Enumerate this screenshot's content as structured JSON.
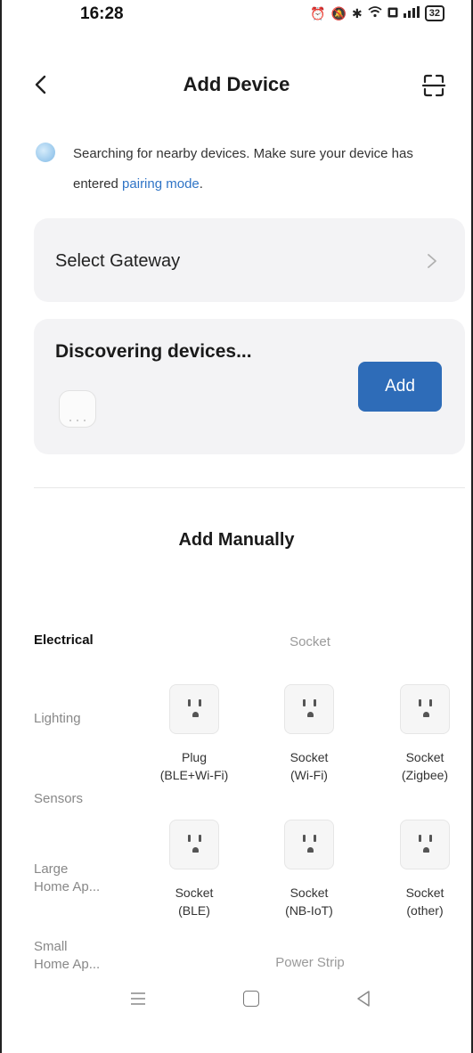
{
  "status_bar": {
    "time": "16:28",
    "battery": "32",
    "icons": [
      "alarm-icon",
      "mute-icon",
      "bluetooth-icon",
      "wifi-icon",
      "data-icon",
      "signal-icon",
      "battery-icon"
    ]
  },
  "header": {
    "title": "Add Device",
    "back_icon": "chevron-left-icon",
    "scan_icon": "scan-icon"
  },
  "info": {
    "text": "Searching for nearby devices. Make sure your device has entered ",
    "link": "pairing mode",
    "suffix": "."
  },
  "gateway": {
    "label": "Select Gateway"
  },
  "discover": {
    "title": "Discovering devices...",
    "add_label": "Add"
  },
  "manual": {
    "title": "Add Manually"
  },
  "categories": [
    {
      "label": "Electrical",
      "active": true
    },
    {
      "label": "Lighting",
      "active": false
    },
    {
      "label": "Sensors",
      "active": false
    },
    {
      "label": "Large\nHome Ap...",
      "active": false
    },
    {
      "label": "Small\nHome Ap...",
      "active": false
    }
  ],
  "groups": {
    "socket": "Socket",
    "power_strip": "Power Strip"
  },
  "tiles": [
    {
      "line1": "Plug",
      "line2": "(BLE+Wi-Fi)"
    },
    {
      "line1": "Socket",
      "line2": "(Wi-Fi)"
    },
    {
      "line1": "Socket",
      "line2": "(Zigbee)"
    },
    {
      "line1": "Socket",
      "line2": "(BLE)"
    },
    {
      "line1": "Socket",
      "line2": "(NB-IoT)"
    },
    {
      "line1": "Socket",
      "line2": "(other)"
    }
  ],
  "colors": {
    "accent": "#2e6cb8",
    "link": "#2f74c6",
    "card_bg": "#f3f3f5"
  }
}
